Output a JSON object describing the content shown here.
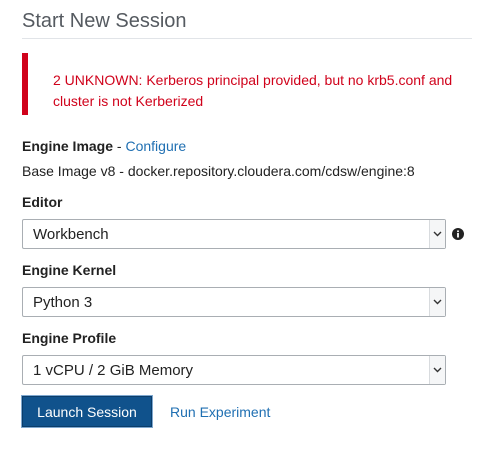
{
  "page": {
    "title": "Start New Session"
  },
  "alert": {
    "message_line1": "2 UNKNOWN: Kerberos principal provided, but no krb5.conf and",
    "message_line2": "cluster is not Kerberized",
    "color": "#d0021b"
  },
  "engine_image": {
    "label": "Engine Image",
    "separator": "-",
    "configure_link": "Configure",
    "value": "Base Image v8 - docker.repository.cloudera.com/cdsw/engine:8"
  },
  "editor": {
    "label": "Editor",
    "selected": "Workbench",
    "info_icon": "info-circle-icon"
  },
  "engine_kernel": {
    "label": "Engine Kernel",
    "selected": "Python 3"
  },
  "engine_profile": {
    "label": "Engine Profile",
    "selected": "1 vCPU / 2 GiB Memory"
  },
  "actions": {
    "launch_label": "Launch Session",
    "run_experiment_label": "Run Experiment",
    "primary_color": "#10528c",
    "link_color": "#1f6fb2"
  }
}
